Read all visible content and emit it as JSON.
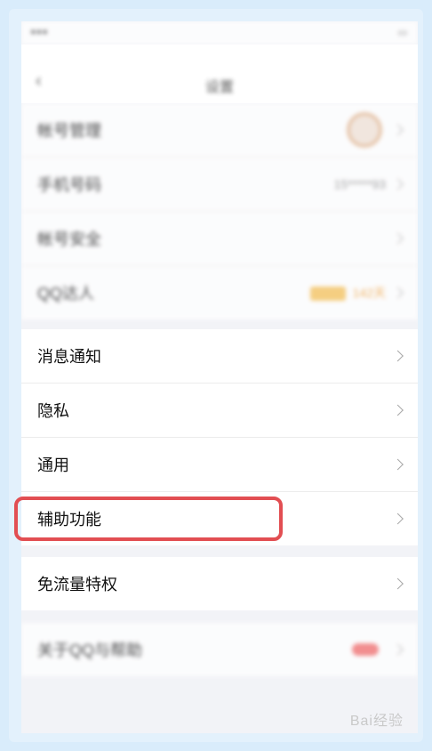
{
  "nav": {
    "title": "设置"
  },
  "group1": [
    {
      "label": "帐号管理"
    },
    {
      "label": "手机号码",
      "value": "15*****93"
    },
    {
      "label": "帐号安全"
    },
    {
      "label": "QQ达人",
      "value": "142天"
    }
  ],
  "group2": [
    {
      "label": "消息通知"
    },
    {
      "label": "隐私"
    },
    {
      "label": "通用"
    },
    {
      "label": "辅助功能"
    }
  ],
  "group3": [
    {
      "label": "免流量特权"
    }
  ],
  "group4": [
    {
      "label": "关于QQ与帮助"
    }
  ],
  "watermark": "Bai经验"
}
